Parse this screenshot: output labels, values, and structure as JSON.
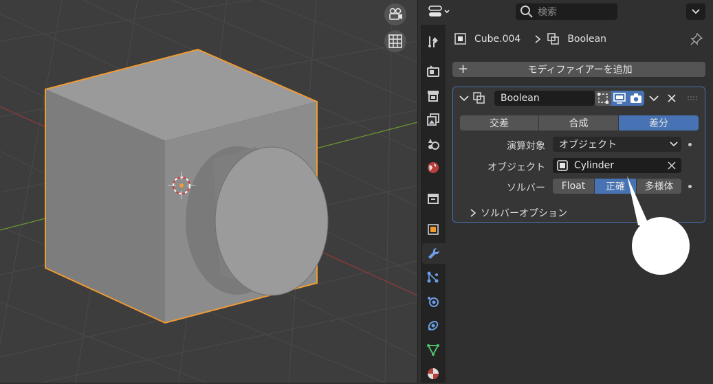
{
  "viewport": {
    "camera_button": {
      "icon": "camera-icon"
    },
    "grid_button": {
      "icon": "grid-icon"
    }
  },
  "header": {
    "editor_type_icon": "editor-type-icon",
    "search_placeholder": "検索"
  },
  "tabs": [
    {
      "name": "tool",
      "icon": "tool-icon"
    },
    {
      "name": "render",
      "icon": "render-icon"
    },
    {
      "name": "output",
      "icon": "output-icon"
    },
    {
      "name": "view-layer",
      "icon": "view-layer-icon"
    },
    {
      "name": "scene",
      "icon": "scene-icon"
    },
    {
      "name": "world",
      "icon": "world-icon"
    },
    {
      "name": "collection",
      "icon": "collection-icon"
    },
    {
      "name": "object",
      "icon": "object-icon"
    },
    {
      "name": "modifiers",
      "icon": "wrench-icon",
      "active": true
    },
    {
      "name": "particles",
      "icon": "particles-icon"
    },
    {
      "name": "physics",
      "icon": "physics-icon"
    },
    {
      "name": "constraints",
      "icon": "constraints-icon"
    },
    {
      "name": "data",
      "icon": "data-icon"
    },
    {
      "name": "material",
      "icon": "material-icon"
    }
  ],
  "breadcrumb": {
    "object": "Cube.004",
    "modifier": "Boolean"
  },
  "add_modifier": {
    "label": "モディファイアーを追加"
  },
  "modifier": {
    "name": "Boolean",
    "operations": [
      "交差",
      "合成",
      "差分"
    ],
    "selected_operation": "差分",
    "operand_label": "演算対象",
    "operand_value": "オブジェクト",
    "object_label": "オブジェクト",
    "object_value": "Cylinder",
    "solver_label": "ソルバー",
    "solvers": [
      "Float",
      "正確",
      "多様体"
    ],
    "selected_solver": "正確",
    "solver_options_label": "ソルバーオプション"
  },
  "colors": {
    "accent": "#4772b3",
    "selection": "#f09a33",
    "panel": "#303030",
    "viewport": "#3d3d3d"
  }
}
